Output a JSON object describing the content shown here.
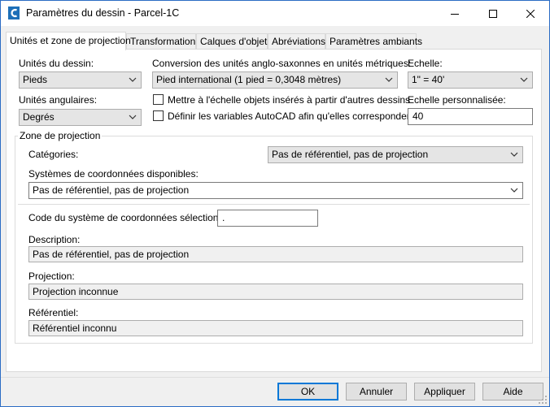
{
  "window": {
    "title": "Paramètres du dessin - Parcel-1C",
    "accent_color": "#2b6cc4",
    "app_icon": "civil3d-c-icon"
  },
  "tabs": [
    {
      "label": "Unités et zone de projection",
      "active": true
    },
    {
      "label": "Transformation",
      "active": false
    },
    {
      "label": "Calques d'objet",
      "active": false
    },
    {
      "label": "Abréviations",
      "active": false
    },
    {
      "label": "Paramètres ambiants",
      "active": false
    }
  ],
  "units": {
    "drawing_units_label": "Unités du dessin:",
    "drawing_units_value": "Pieds",
    "conversion_label": "Conversion des unités anglo-saxonnes en unités métriques:",
    "conversion_value": "Pied international (1 pied = 0,3048 mètres)",
    "scale_label": "Echelle:",
    "scale_value": "1\" = 40'",
    "angular_label": "Unités angulaires:",
    "angular_value": "Degrés",
    "scale_inserted_label": "Mettre à l'échelle objets insérés à partir d'autres dessins",
    "scale_inserted_checked": false,
    "set_vars_label": "Définir les variables AutoCAD afin qu'elles correspondent",
    "set_vars_checked": false,
    "custom_scale_label": "Echelle personnalisée:",
    "custom_scale_value": "40"
  },
  "zone": {
    "group_title": "Zone de projection",
    "categories_label": "Catégories:",
    "categories_value": "Pas de référentiel, pas de projection",
    "available_label": "Systèmes de coordonnées disponibles:",
    "available_value": "Pas de référentiel, pas de projection",
    "selected_code_label": "Code du système de coordonnées sélectionné:",
    "selected_code_value": ".",
    "description_label": "Description:",
    "description_value": "Pas de référentiel, pas de projection",
    "projection_label": "Projection:",
    "projection_value": "Projection inconnue",
    "datum_label": "Référentiel:",
    "datum_value": "Référentiel inconnu"
  },
  "buttons": {
    "ok": "OK",
    "cancel": "Annuler",
    "apply": "Appliquer",
    "help": "Aide"
  }
}
